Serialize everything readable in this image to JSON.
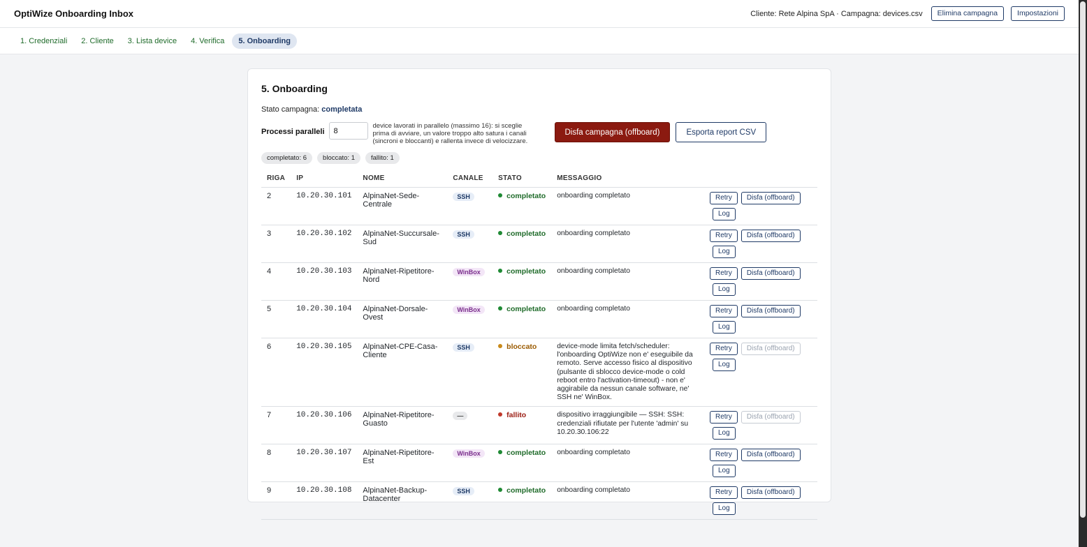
{
  "app": {
    "title": "OptiWize Onboarding Inbox"
  },
  "header": {
    "client_info": "Cliente: Rete Alpina SpA · Campagna: devices.csv",
    "delete_label": "Elimina campagna",
    "settings_label": "Impostazioni"
  },
  "steps": [
    {
      "label": "1. Credenziali"
    },
    {
      "label": "2. Cliente"
    },
    {
      "label": "3. Lista device"
    },
    {
      "label": "4. Verifica"
    },
    {
      "label": "5. Onboarding"
    }
  ],
  "onboarding": {
    "title": "5. Onboarding",
    "stato_label": "Stato campagna:",
    "stato_value": "completata",
    "parallel_label": "Processi paralleli",
    "parallel_value": "8",
    "parallel_help": "device lavorati in parallelo (massimo 16): si sceglie prima di avviare, un valore troppo alto satura i canali (sincroni e bloccanti) e rallenta invece di velocizzare.",
    "offboard_label": "Disfa campagna (offboard)",
    "export_label": "Esporta report CSV",
    "chips": [
      "completato: 6",
      "bloccato: 1",
      "fallito: 1"
    ]
  },
  "table": {
    "headers": [
      "RIGA",
      "IP",
      "NOME",
      "CANALE",
      "STATO",
      "MESSAGGIO"
    ],
    "rows": [
      {
        "riga": "2",
        "ip": "10.20.30.101",
        "nome": "AlpinaNet-Sede-Centrale",
        "canale": "SSH",
        "stato": "completato",
        "messaggio": "onboarding completato",
        "retry": "Retry",
        "offboard": "Disfa (offboard)",
        "log": "Log"
      },
      {
        "riga": "3",
        "ip": "10.20.30.102",
        "nome": "AlpinaNet-Succursale-Sud",
        "canale": "SSH",
        "stato": "completato",
        "messaggio": "onboarding completato",
        "retry": "Retry",
        "offboard": "Disfa (offboard)",
        "log": "Log"
      },
      {
        "riga": "4",
        "ip": "10.20.30.103",
        "nome": "AlpinaNet-Ripetitore-Nord",
        "canale": "WinBox",
        "stato": "completato",
        "messaggio": "onboarding completato",
        "retry": "Retry",
        "offboard": "Disfa (offboard)",
        "log": "Log"
      },
      {
        "riga": "5",
        "ip": "10.20.30.104",
        "nome": "AlpinaNet-Dorsale-Ovest",
        "canale": "WinBox",
        "stato": "completato",
        "messaggio": "onboarding completato",
        "retry": "Retry",
        "offboard": "Disfa (offboard)",
        "log": "Log"
      },
      {
        "riga": "6",
        "ip": "10.20.30.105",
        "nome": "AlpinaNet-CPE-Casa-Cliente",
        "canale": "SSH",
        "stato": "bloccato",
        "messaggio": "device-mode limita fetch/scheduler: l'onboarding OptiWize non e' eseguibile da remoto. Serve accesso fisico al dispositivo (pulsante di sblocco device-mode o cold reboot entro l'activation-timeout) - non e' aggirabile da nessun canale software, ne' SSH ne' WinBox.",
        "retry": "Retry",
        "offboard": "Disfa (offboard)",
        "log": "Log"
      },
      {
        "riga": "7",
        "ip": "10.20.30.106",
        "nome": "AlpinaNet-Ripetitore-Guasto",
        "canale": "—",
        "stato": "fallito",
        "messaggio": "dispositivo irraggiungibile — SSH: SSH: credenziali rifiutate per l'utente 'admin' su 10.20.30.106:22",
        "retry": "Retry",
        "offboard": "Disfa (offboard)",
        "log": "Log"
      },
      {
        "riga": "8",
        "ip": "10.20.30.107",
        "nome": "AlpinaNet-Ripetitore-Est",
        "canale": "WinBox",
        "stato": "completato",
        "messaggio": "onboarding completato",
        "retry": "Retry",
        "offboard": "Disfa (offboard)",
        "log": "Log"
      },
      {
        "riga": "9",
        "ip": "10.20.30.108",
        "nome": "AlpinaNet-Backup-Datacenter",
        "canale": "SSH",
        "stato": "completato",
        "messaggio": "onboarding completato",
        "retry": "Retry",
        "offboard": "Disfa (offboard)",
        "log": "Log"
      }
    ]
  },
  "colors": {
    "accent": "#1f3a66",
    "danger": "#8b1a10",
    "ok": "#1f6b2a",
    "warn": "#9a5a00",
    "fail": "#9b1c12"
  }
}
